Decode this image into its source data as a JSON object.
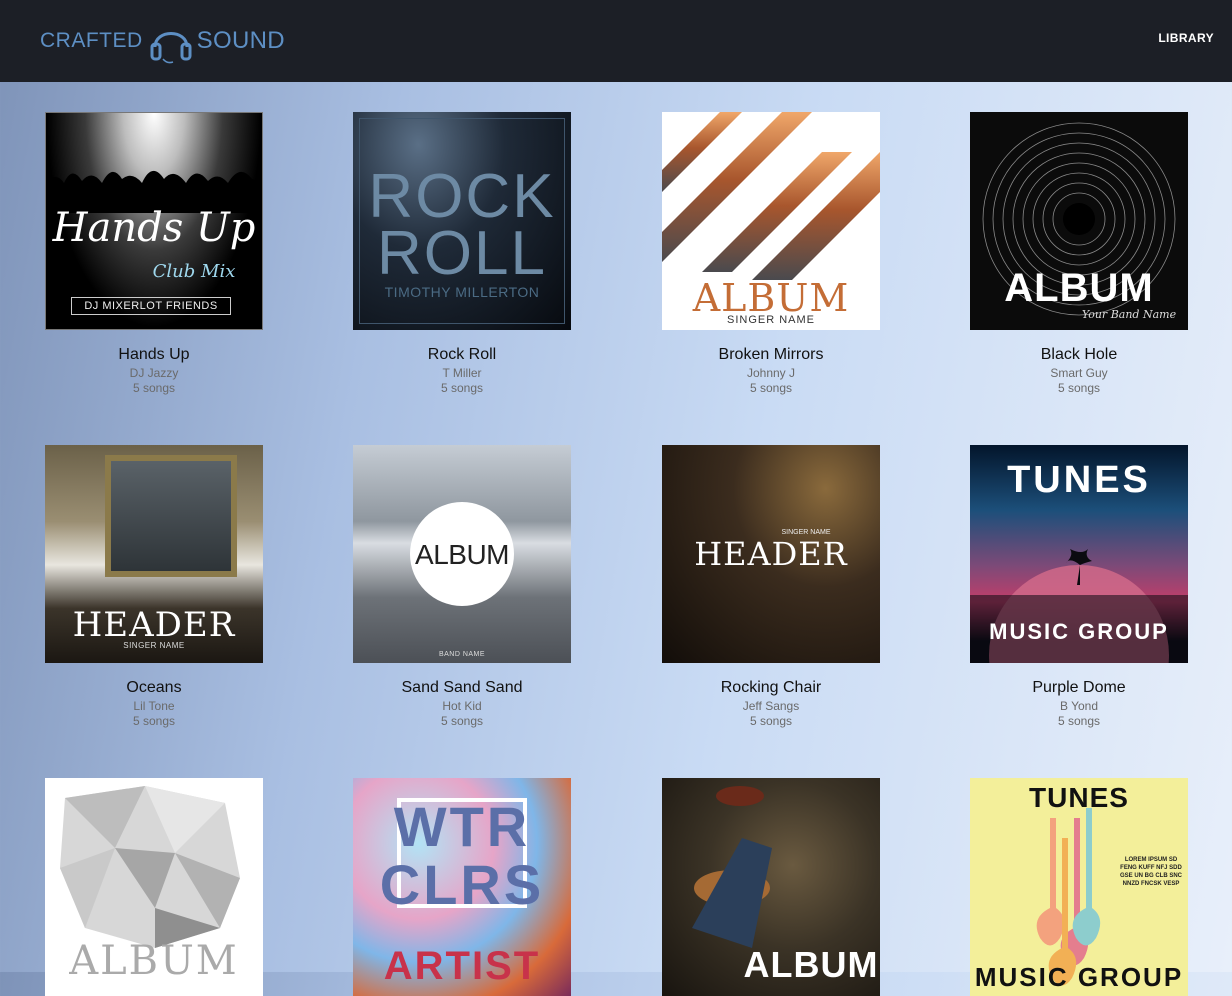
{
  "header": {
    "logo": {
      "word1": "CRAFTED",
      "word2": "SOUND",
      "icon": "headphones-icon"
    },
    "nav": {
      "library_label": "LIBRARY"
    }
  },
  "albums": [
    {
      "title": "Hands Up",
      "artist": "DJ Jazzy",
      "count": "5 songs",
      "cover": {
        "line1": "Hands Up",
        "line2": "Club Mix",
        "line3": "DJ MIXERLOT  FRIENDS"
      }
    },
    {
      "title": "Rock Roll",
      "artist": "T Miller",
      "count": "5 songs",
      "cover": {
        "line1": "ROCK",
        "line2": "ROLL",
        "line3": "TIMOTHY MILLERTON"
      }
    },
    {
      "title": "Broken Mirrors",
      "artist": "Johnny J",
      "count": "5 songs",
      "cover": {
        "line1": "ALBUM",
        "line2": "SINGER NAME"
      }
    },
    {
      "title": "Black Hole",
      "artist": "Smart Guy",
      "count": "5 songs",
      "cover": {
        "line1": "ALBUM",
        "line2": "Your Band Name"
      }
    },
    {
      "title": "Oceans",
      "artist": "Lil Tone",
      "count": "5 songs",
      "cover": {
        "line1": "HEADER",
        "line2": "SINGER NAME"
      }
    },
    {
      "title": "Sand Sand Sand",
      "artist": "Hot Kid",
      "count": "5 songs",
      "cover": {
        "line1": "ALBUM",
        "line2": "BAND NAME"
      }
    },
    {
      "title": "Rocking Chair",
      "artist": "Jeff Sangs",
      "count": "5 songs",
      "cover": {
        "line1": "HEADER",
        "line2": "SINGER NAME"
      }
    },
    {
      "title": "Purple Dome",
      "artist": "B Yond",
      "count": "5 songs",
      "cover": {
        "line1": "TUNES",
        "line2": "MUSIC GROUP"
      }
    },
    {
      "cover": {
        "line1": "ALBUM"
      }
    },
    {
      "cover": {
        "line1": "WTR",
        "line2": "CLRS",
        "line3": "ARTIST"
      }
    },
    {
      "cover": {
        "line1": "ALBUM"
      }
    },
    {
      "cover": {
        "line1": "TUNES",
        "line2": "LOREM IPSUM SD FENG KUFF NFJ SDD GSE UN BG CLB SNC NNZD FNCSK VESP",
        "line3": "MUSIC GROUP"
      }
    }
  ]
}
